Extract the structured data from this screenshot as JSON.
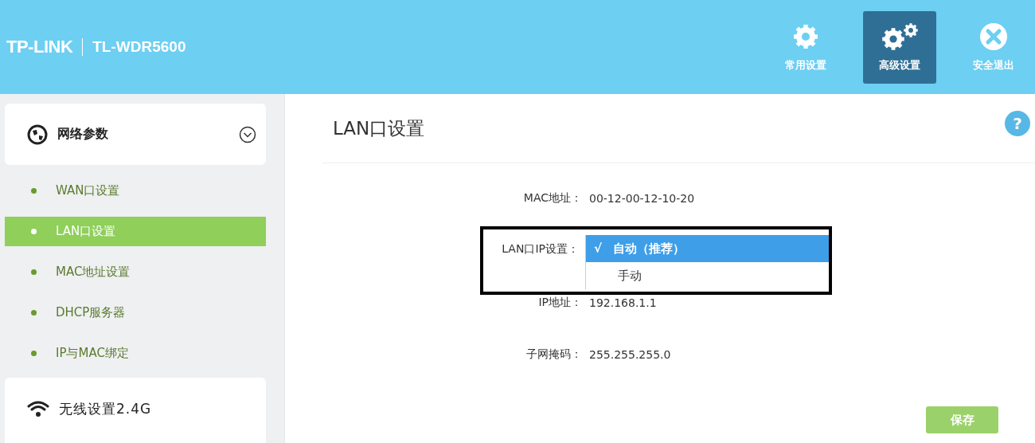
{
  "header": {
    "brand": "TP-LINK",
    "model": "TL-WDR5600",
    "nav": [
      {
        "label": "常用设置",
        "kind": "gear",
        "selected": false
      },
      {
        "label": "高级设置",
        "kind": "gears",
        "selected": true
      },
      {
        "label": "安全退出",
        "kind": "exit",
        "selected": false
      }
    ]
  },
  "sidebar": {
    "groups": [
      {
        "label": "网络参数",
        "kind": "globe",
        "expanded": true,
        "children": [
          {
            "label": "WAN口设置",
            "selected": false
          },
          {
            "label": "LAN口设置",
            "selected": true
          },
          {
            "label": "MAC地址设置",
            "selected": false
          },
          {
            "label": "DHCP服务器",
            "selected": false
          },
          {
            "label": "IP与MAC绑定",
            "selected": false
          }
        ]
      },
      {
        "label": "无线设置2.4G",
        "kind": "wifi",
        "expanded": false
      }
    ]
  },
  "main": {
    "title": "LAN口设置",
    "help": "?",
    "mac": {
      "label": "MAC地址：",
      "value": "00-12-00-12-10-20"
    },
    "ip_mode": {
      "label": "LAN口IP设置：",
      "check_mark": "√",
      "options": [
        {
          "label": "自动（推荐）",
          "selected": true
        },
        {
          "label": "手动",
          "selected": false
        }
      ]
    },
    "ip": {
      "label": "IP地址：",
      "value": "192.168.1.1"
    },
    "subnet": {
      "label": "子网掩码：",
      "value": "255.255.255.0"
    },
    "save_button": "保存"
  }
}
